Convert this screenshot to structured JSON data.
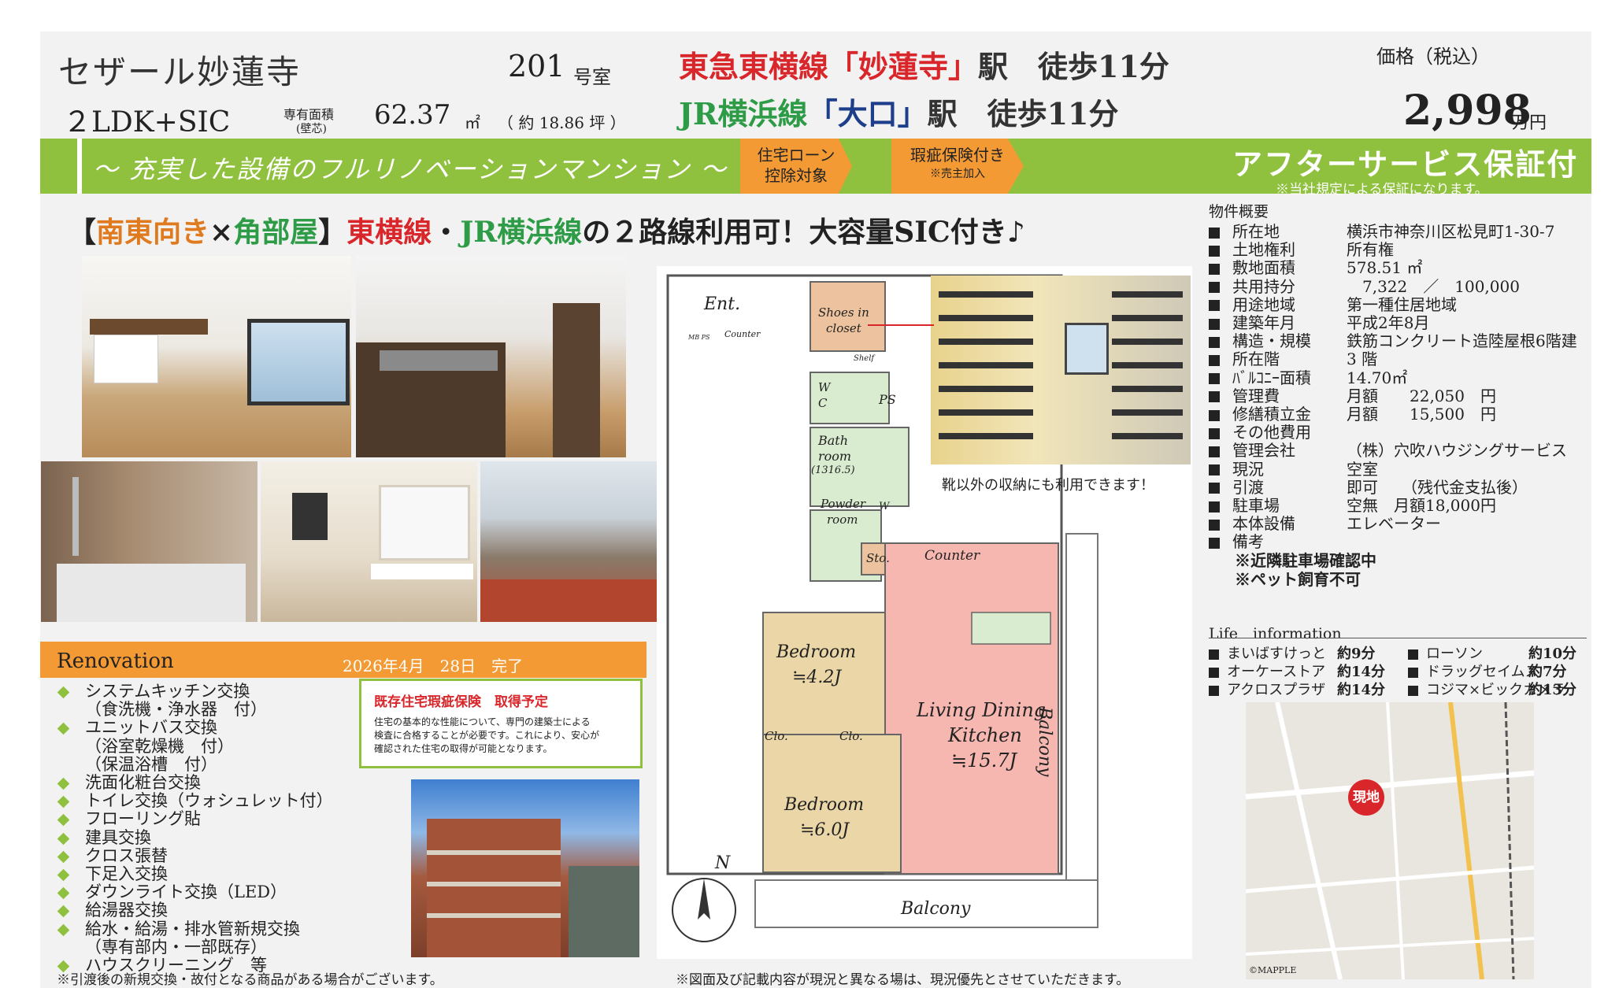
{
  "header": {
    "building_name": "セザール妙蓮寺",
    "room_no": "201",
    "room_suffix": "号室",
    "layout": "２LDK+SIC",
    "area_label": "専有面積",
    "area_sub": "(壁芯)",
    "area_value": "62.37",
    "area_unit": "㎡",
    "area_tsubo": "（ 約 18.86 坪 ）",
    "access1_line": "東急東横線",
    "access1_station": "「妙蓮寺」",
    "access1_rest": "駅　徒歩11分",
    "access2_line": "JR横浜線",
    "access2_station": "「大口」",
    "access2_rest": "駅　徒歩11分",
    "price_label": "価格（税込）",
    "price_value": "2,998",
    "price_unit": "万円"
  },
  "banner": {
    "tagline": "～ 充実した設備のフルリノベーションマンション ～",
    "tag1_line1": "住宅ローン",
    "tag1_line2": "控除対象",
    "tag2_line1": "瑕疵保険付き",
    "tag2_line2": "※売主加入",
    "after_service": "アフターサービス保証付",
    "after_note": "※当社規定による保証になります。"
  },
  "headline": {
    "p1": "【",
    "p2": "南東向き",
    "p3": "×",
    "p4": "角部屋",
    "p5": "】",
    "p6": "東横線",
    "p7": "・",
    "p8": "JR横浜線",
    "p9": "の２路線利用可！大容量SIC付き♪"
  },
  "floorplan": {
    "ent": "Ent.",
    "shoes1": "Shoes in",
    "shoes2": "closet",
    "shelf": "Shelf",
    "counter_small": "Counter",
    "mb": "MB PS",
    "wc1": "W",
    "wc2": "C",
    "ps": "PS",
    "bath1": "Bath",
    "bath2": "room",
    "bath3": "(1316.5)",
    "powder1": "Powder",
    "powder2": "room",
    "w": "W",
    "sto": "Sto.",
    "counter": "Counter",
    "bed1": "Bedroom",
    "bed1_size": "≒4.2J",
    "clo1": "Clo.",
    "clo2": "Clo.",
    "bed2": "Bedroom",
    "bed2_size": "≒6.0J",
    "ldk1": "Living Dining",
    "ldk2": "Kitchen",
    "ldk_size": "≒15.7J",
    "balcony_side": "Balcony",
    "balcony_bottom": "Balcony",
    "north": "N",
    "closet_caption": "靴以外の収納にも利用できます！",
    "note": "※図面及び記載内容が現況と異なる場は、現況優先とさせていただきます。"
  },
  "renovation": {
    "title": "Renovation",
    "date": "2026年4月　28日　完了",
    "items": [
      "システムキッチン交換",
      "（食洗機・浄水器　付）",
      "ユニットバス交換",
      "（浴室乾燥機　付）",
      "（保温浴槽　付）",
      "洗面化粧台交換",
      "トイレ交換（ウォシュレット付）",
      "フローリング貼",
      "建具交換",
      "クロス張替",
      "下足入交換",
      "ダウンライト交換（LED）",
      "給湯器交換",
      "給水・給湯・排水管新規交換",
      "（専有部内・一部既存）",
      "ハウスクリーニング　等"
    ],
    "footnote": "※引渡後の新規交換・故付となる商品がある場合がございます。",
    "insurance_title": "既存住宅瑕疵保険　取得予定",
    "insurance_body1": "住宅の基本的な性能について、専門の建築士による",
    "insurance_body2": "検査に合格することが必要です。これにより、安心が",
    "insurance_body3": "確認された住宅の取得が可能となります。"
  },
  "specs": {
    "title": "物件概要",
    "rows": [
      {
        "label": "所在地",
        "value": "横浜市神奈川区松見町1-30-7"
      },
      {
        "label": "土地権利",
        "value": "所有権"
      },
      {
        "label": "敷地面積",
        "value": "578.51 ㎡"
      },
      {
        "label": "共用持分",
        "value": "　7,322　／　100,000"
      },
      {
        "label": "用途地域",
        "value": "第一種住居地域"
      },
      {
        "label": "建築年月",
        "value": "平成2年8月"
      },
      {
        "label": "構造・規模",
        "value": "鉄筋コンクリート造陸屋根6階建"
      },
      {
        "label": "所在階",
        "value": "3 階"
      },
      {
        "label": "ﾊﾞﾙｺﾆｰ面積",
        "value": "14.70㎡"
      },
      {
        "label": "管理費",
        "value": "月額　　22,050　円"
      },
      {
        "label": "修繕積立金",
        "value": "月額　　15,500　円"
      },
      {
        "label": "その他費用",
        "value": ""
      },
      {
        "label": "管理会社",
        "value": "（株）穴吹ハウジングサービス"
      },
      {
        "label": "現況",
        "value": "空室"
      },
      {
        "label": "引渡",
        "value": "即可　　（残代金支払後）"
      },
      {
        "label": "駐車場",
        "value": "空無　月額18,000円"
      },
      {
        "label": "本体設備",
        "value": "エレベーター"
      },
      {
        "label": "備考",
        "value": ""
      }
    ],
    "remark1": "※近隣駐車場確認中",
    "remark2": "※ペット飼育不可"
  },
  "life": {
    "title": "Life　information",
    "left": [
      {
        "name": "まいばすけっと",
        "dist": "約9分"
      },
      {
        "name": "オーケーストア",
        "dist": "約14分"
      },
      {
        "name": "アクロスプラザ",
        "dist": "約14分"
      }
    ],
    "right": [
      {
        "name": "ローソン",
        "dist": "約10分"
      },
      {
        "name": "ドラッグセイムス",
        "dist": "約7分"
      },
      {
        "name": "コジマ×ビックカメラ",
        "dist": "約13分"
      }
    ],
    "map_marker": "現地",
    "map_brand": "©MAPPLE"
  },
  "colors": {
    "green": "#8fc03e",
    "orange": "#f39a34",
    "red": "#d9262b",
    "ldk": "#f6b7b1",
    "bedroom": "#ead6a6",
    "wet": "#d9ecd0"
  }
}
